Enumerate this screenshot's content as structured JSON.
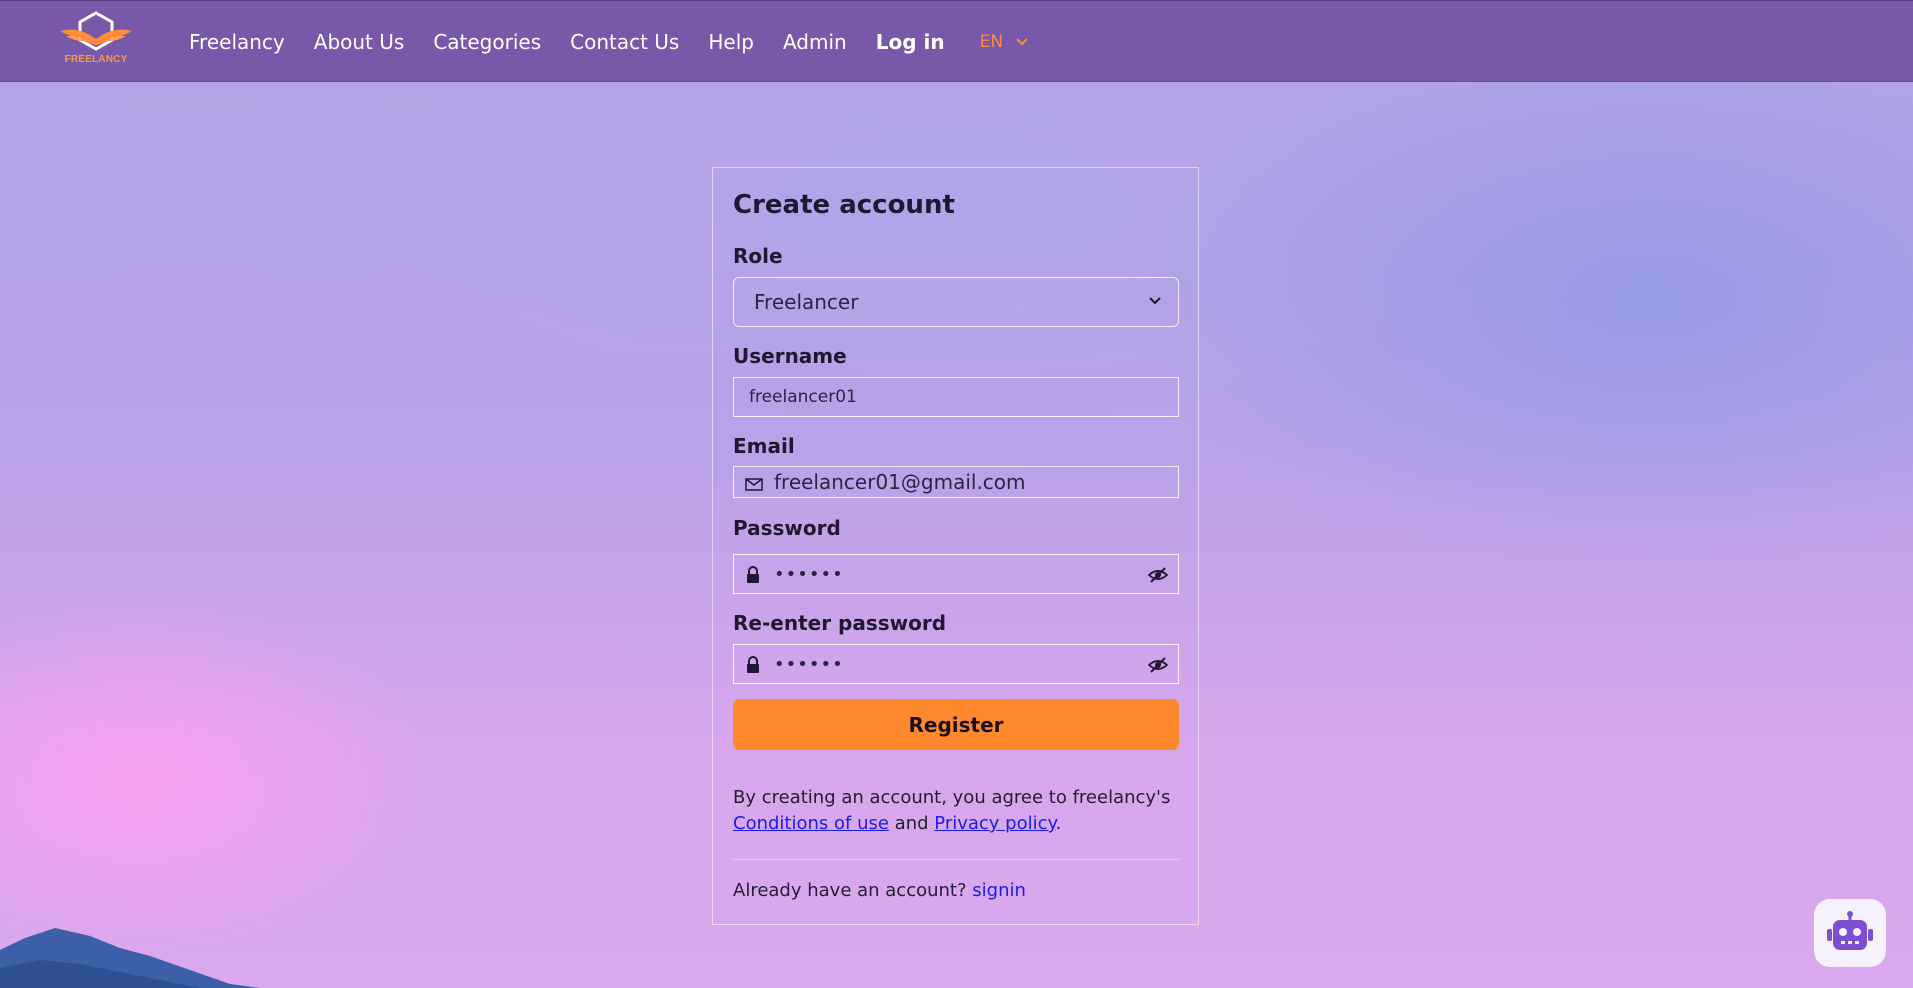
{
  "header": {
    "logo_text": "FREELANCY",
    "nav": [
      "Freelancy",
      "About Us",
      "Categories",
      "Contact Us",
      "Help",
      "Admin",
      "Log in"
    ],
    "language": "EN"
  },
  "form": {
    "title": "Create account",
    "role_label": "Role",
    "role_value": "Freelancer",
    "username_label": "Username",
    "username_value": "freelancer01",
    "email_label": "Email",
    "email_value": "freelancer01@gmail.com",
    "password_label": "Password",
    "password_value": "••••••",
    "reenter_label": "Re-enter password",
    "reenter_value": "••••••",
    "register_label": "Register",
    "legal_prefix": "By creating an account, you agree to freelancy's",
    "conditions_link": "Conditions of use",
    "legal_and": "and",
    "privacy_link": "Privacy policy",
    "legal_suffix": ".",
    "signin_prompt": "Already have an account?",
    "signin_link": "signin"
  },
  "colors": {
    "header": "#7858a9",
    "accent": "#ff8a2e",
    "link": "#1b1be8"
  },
  "icons": [
    "freelancy-logo-icon",
    "chevron-down-icon",
    "mail-icon",
    "lock-icon",
    "eye-off-icon",
    "chatbot-icon"
  ]
}
